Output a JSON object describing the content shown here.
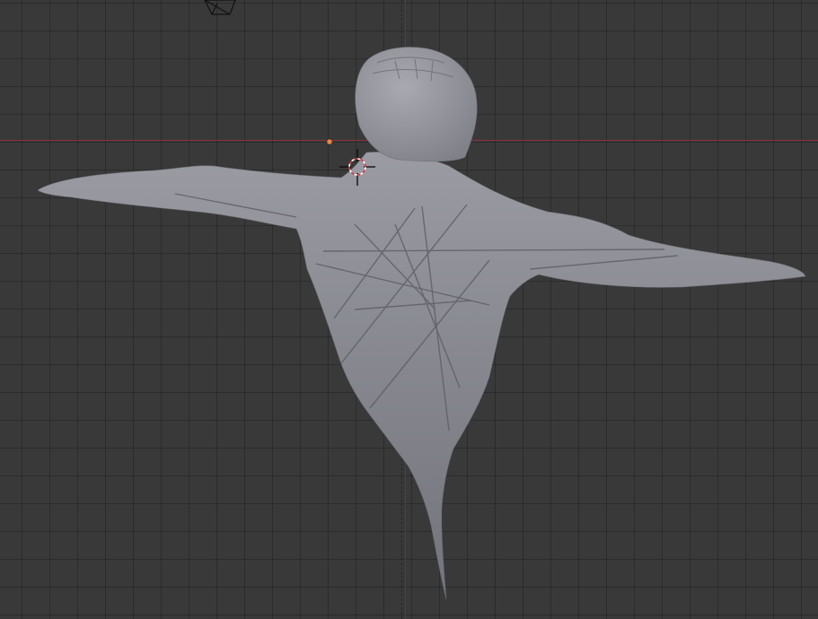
{
  "viewport": {
    "grid_color": "#2f2f2f",
    "background_color": "#393939",
    "axis_x_color": "#8a2f38",
    "axis_y_color": "#2b3c9b"
  },
  "objects": {
    "mesh_type": "sculpted-humanoid-mesh",
    "mesh_color": "#8a8b94",
    "origin_color": "#e08a45",
    "camera_icon": "camera-icon",
    "cursor_icon": "3d-cursor-icon"
  }
}
